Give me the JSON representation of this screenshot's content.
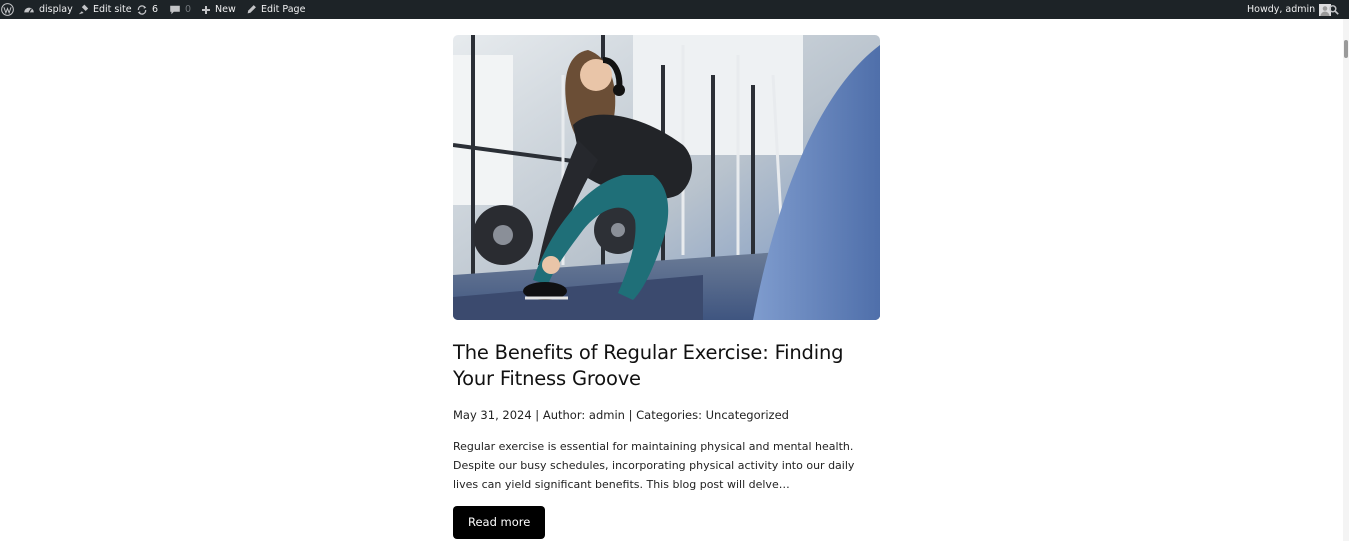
{
  "adminbar": {
    "site_name": "display",
    "edit_site": "Edit site",
    "updates_count": "6",
    "comments_count": "0",
    "new_label": "New",
    "edit_page": "Edit Page",
    "howdy": "Howdy, admin"
  },
  "post": {
    "title": "The Benefits of Regular Exercise: Finding Your Fitness Groove",
    "date": "May 31, 2024",
    "sep1": " | Author: ",
    "author": "admin",
    "sep2": " | Categories: ",
    "category": "Uncategorized",
    "excerpt": "Regular exercise is essential for maintaining physical and mental health. Despite our busy schedules, incorporating physical activity into our daily lives can yield significant benefits. This blog post will delve…",
    "read_more": "Read more"
  },
  "colors": {
    "adminbar_bg": "#1d2327",
    "button_bg": "#000000"
  }
}
